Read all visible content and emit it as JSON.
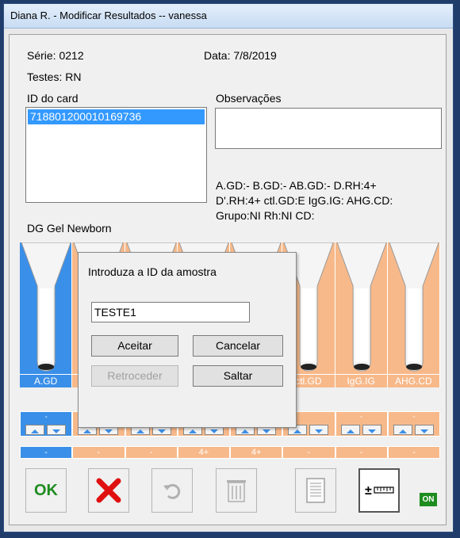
{
  "window": {
    "title": "Diana R. - Modificar Resultados -- vanessa"
  },
  "info": {
    "serie": "Série: 0212",
    "data": "Data: 7/8/2019",
    "testes": "Testes: RN"
  },
  "card": {
    "label": "ID do card",
    "selected_id": "718801200010169736"
  },
  "observacoes": {
    "label": "Observações",
    "value": ""
  },
  "summary": {
    "line1": "A.GD:-  B.GD:-  AB.GD:-  D.RH:4+",
    "line2": "D'.RH:4+  ctl.GD:E  IgG.IG:  AHG.CD:",
    "line3": "Grupo:NI  Rh:NI  CD:"
  },
  "card_type": "DG Gel Newborn",
  "tubes": [
    {
      "label": "A.GD",
      "color": "#3a8fe8"
    },
    {
      "label": "",
      "color": "#f7b98a"
    },
    {
      "label": "",
      "color": "#f7b98a"
    },
    {
      "label": "",
      "color": "#f7b98a"
    },
    {
      "label": "",
      "color": "#f7b98a"
    },
    {
      "label": "ctl.GD",
      "color": "#f7b98a"
    },
    {
      "label": "IgG.IG",
      "color": "#f7b98a"
    },
    {
      "label": "AHG.CD",
      "color": "#f7b98a"
    }
  ],
  "controls": [
    "-",
    "",
    "",
    "",
    "",
    "",
    "-",
    "-"
  ],
  "results": [
    "-",
    "-",
    "-",
    "4+",
    "4+",
    "-",
    "-",
    "-"
  ],
  "dialog": {
    "prompt": "Introduza a ID da amostra",
    "input_value": "TESTE1",
    "accept": "Aceitar",
    "cancel": "Cancelar",
    "back": "Retroceder",
    "skip": "Saltar"
  },
  "toolbar": {
    "ok_label": "OK",
    "on_badge": "ON"
  },
  "colors": {
    "blue": "#3a8fe8",
    "peach": "#f7b98a",
    "selection": "#3399ff",
    "green": "#1e8c1e",
    "red": "#e01010"
  }
}
